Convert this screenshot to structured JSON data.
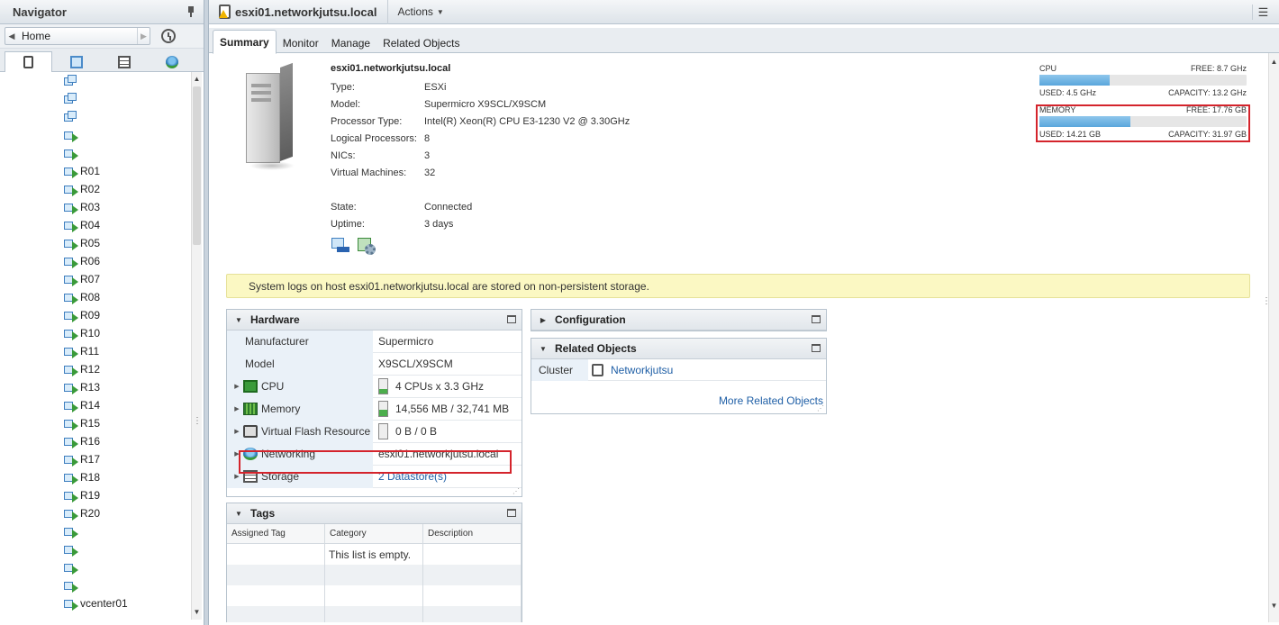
{
  "navigator": {
    "title": "Navigator",
    "home_label": "Home",
    "tabs": [
      "hosts-clusters-icon",
      "vms-templates-icon",
      "storage-icon",
      "networking-icon"
    ],
    "tree_items": [
      {
        "label": "",
        "icon": "vm-template-icon"
      },
      {
        "label": "",
        "icon": "vm-template-icon"
      },
      {
        "label": "",
        "icon": "vm-template-icon"
      },
      {
        "label": "",
        "icon": "vm-on-icon"
      },
      {
        "label": "",
        "icon": "vm-on-icon"
      },
      {
        "label": "R01",
        "icon": "vm-on-icon"
      },
      {
        "label": "R02",
        "icon": "vm-on-icon"
      },
      {
        "label": "R03",
        "icon": "vm-on-icon"
      },
      {
        "label": "R04",
        "icon": "vm-on-icon"
      },
      {
        "label": "R05",
        "icon": "vm-on-icon"
      },
      {
        "label": "R06",
        "icon": "vm-on-icon"
      },
      {
        "label": "R07",
        "icon": "vm-on-icon"
      },
      {
        "label": "R08",
        "icon": "vm-on-icon"
      },
      {
        "label": "R09",
        "icon": "vm-on-icon"
      },
      {
        "label": "R10",
        "icon": "vm-on-icon"
      },
      {
        "label": "R11",
        "icon": "vm-on-icon"
      },
      {
        "label": "R12",
        "icon": "vm-on-icon"
      },
      {
        "label": "R13",
        "icon": "vm-on-icon"
      },
      {
        "label": "R14",
        "icon": "vm-on-icon"
      },
      {
        "label": "R15",
        "icon": "vm-on-icon"
      },
      {
        "label": "R16",
        "icon": "vm-on-icon"
      },
      {
        "label": "R17",
        "icon": "vm-on-icon"
      },
      {
        "label": "R18",
        "icon": "vm-on-icon"
      },
      {
        "label": "R19",
        "icon": "vm-on-icon"
      },
      {
        "label": "R20",
        "icon": "vm-on-icon"
      },
      {
        "label": "",
        "icon": "vm-on-icon"
      },
      {
        "label": "",
        "icon": "vm-on-icon"
      },
      {
        "label": "",
        "icon": "vm-on-icon"
      },
      {
        "label": "",
        "icon": "vm-on-icon"
      },
      {
        "label": "vcenter01",
        "icon": "vm-on-icon"
      }
    ]
  },
  "header": {
    "host_title": "esxi01.networkjutsu.local",
    "actions_label": "Actions"
  },
  "tabs": [
    "Summary",
    "Monitor",
    "Manage",
    "Related Objects"
  ],
  "summary": {
    "host_name": "esxi01.networkjutsu.local",
    "properties": [
      {
        "label": "Type:",
        "value": "ESXi"
      },
      {
        "label": "Model:",
        "value": "Supermicro X9SCL/X9SCM"
      },
      {
        "label": "Processor Type:",
        "value": "Intel(R) Xeon(R) CPU E3-1230 V2 @ 3.30GHz"
      },
      {
        "label": "Logical Processors:",
        "value": "8"
      },
      {
        "label": "NICs:",
        "value": "3"
      },
      {
        "label": "Virtual Machines:",
        "value": "32"
      },
      {
        "label": "State:",
        "value": "Connected"
      },
      {
        "label": "Uptime:",
        "value": "3 days"
      }
    ]
  },
  "meters": {
    "cpu": {
      "label": "CPU",
      "free": "FREE: 8.7 GHz",
      "used": "USED: 4.5 GHz",
      "capacity": "CAPACITY: 13.2 GHz",
      "fraction": 0.34
    },
    "memory": {
      "label": "MEMORY",
      "free": "FREE: 17.76 GB",
      "used": "USED: 14.21 GB",
      "capacity": "CAPACITY: 31.97 GB",
      "fraction": 0.44
    }
  },
  "alert": "System logs on host esxi01.networkjutsu.local are stored on non-persistent storage.",
  "hardware": {
    "title": "Hardware",
    "rows": [
      {
        "key": "Manufacturer",
        "value": "Supermicro"
      },
      {
        "key": "Model",
        "value": "X9SCL/X9SCM"
      },
      {
        "key": "CPU",
        "value": "4 CPUs x 3.3 GHz",
        "usage": 0.34
      },
      {
        "key": "Memory",
        "value": "14,556 MB / 32,741 MB",
        "usage": 0.44
      },
      {
        "key": "Virtual Flash Resource",
        "value": "0 B / 0 B",
        "usage": 0
      },
      {
        "key": "Networking",
        "value": "esxi01.networkjutsu.local"
      },
      {
        "key": "Storage",
        "value": "2 Datastore(s)"
      }
    ]
  },
  "configuration": {
    "title": "Configuration"
  },
  "related": {
    "title": "Related Objects",
    "cluster_label": "Cluster",
    "cluster_value": "Networkjutsu",
    "more_label": "More Related Objects"
  },
  "tags": {
    "title": "Tags",
    "columns": [
      "Assigned Tag",
      "Category",
      "Description"
    ],
    "empty_text": "This list is empty."
  },
  "colors": {
    "accent": "#1f5fa6",
    "highlight": "#d4242c",
    "alert_bg": "#fbf8c3",
    "meter": "#5aa6dc"
  }
}
